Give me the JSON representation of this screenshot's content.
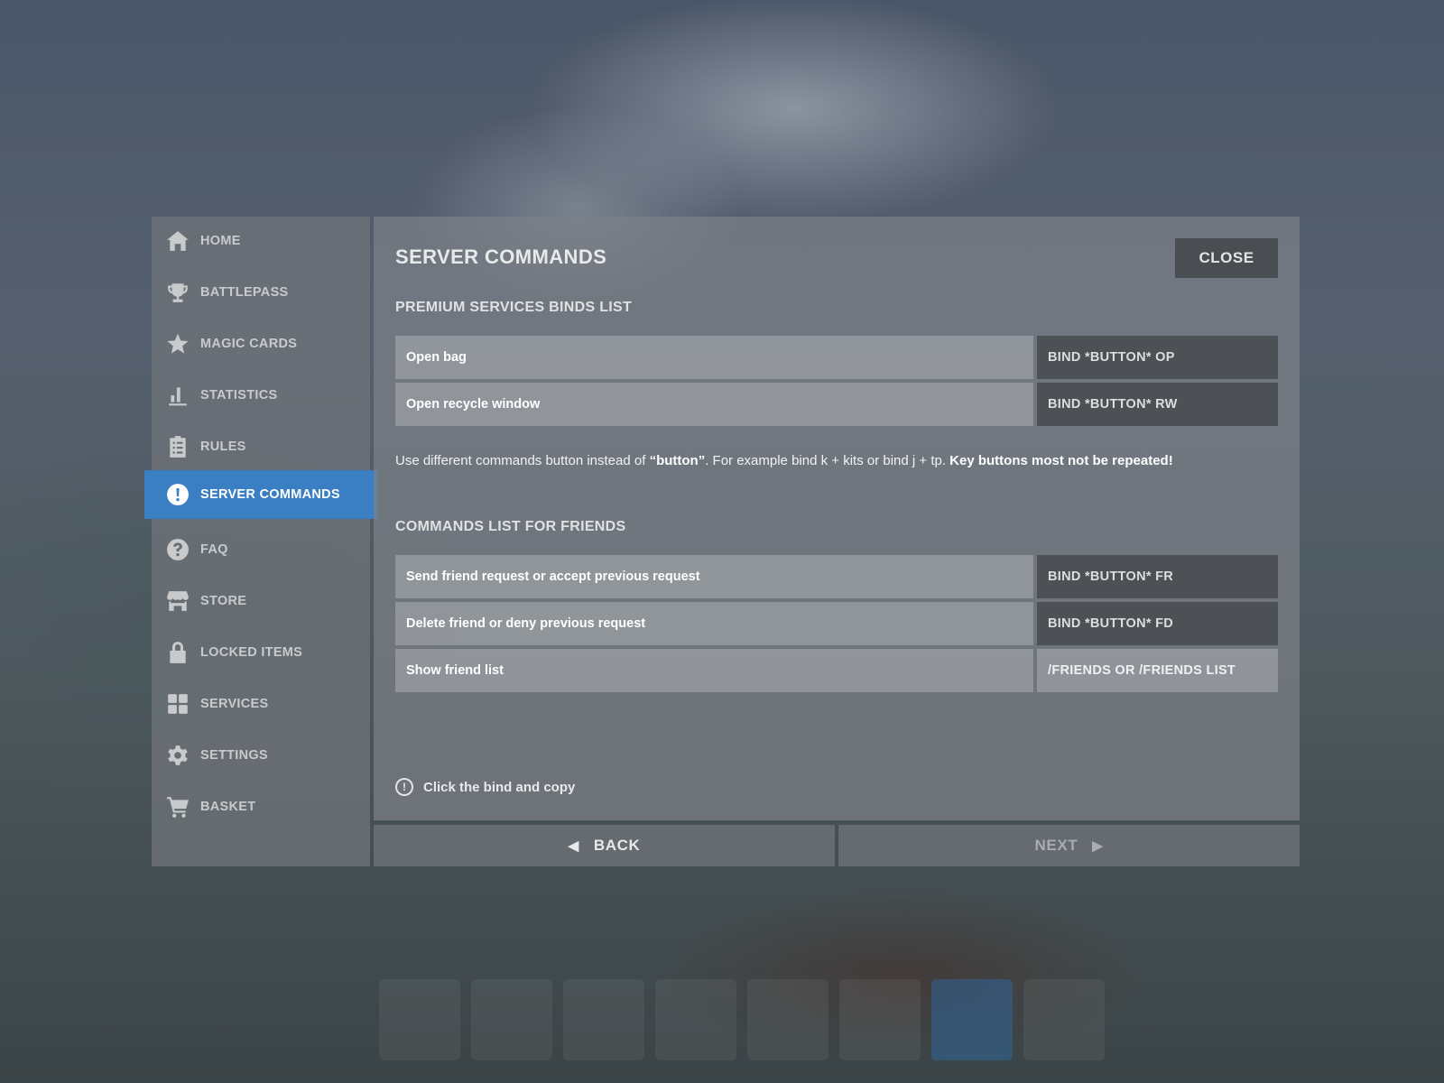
{
  "sidebar": {
    "items": [
      {
        "label": "HOME",
        "icon": "home-icon"
      },
      {
        "label": "BATTLEPASS",
        "icon": "trophy-icon"
      },
      {
        "label": "MAGIC CARDS",
        "icon": "star-icon"
      },
      {
        "label": "STATISTICS",
        "icon": "bar-chart-icon"
      },
      {
        "label": "RULES",
        "icon": "clipboard-icon"
      },
      {
        "label": "SERVER COMMANDS",
        "icon": "exclamation-circle-icon",
        "active": true
      },
      {
        "label": "FAQ",
        "icon": "question-circle-icon"
      },
      {
        "label": "STORE",
        "icon": "store-icon"
      },
      {
        "label": "LOCKED ITEMS",
        "icon": "lock-icon"
      },
      {
        "label": "SERVICES",
        "icon": "grid-icon"
      },
      {
        "label": "SETTINGS",
        "icon": "gear-icon"
      },
      {
        "label": "BASKET",
        "icon": "cart-icon"
      }
    ],
    "active_color": "#3a7fc4"
  },
  "main": {
    "title": "SERVER COMMANDS",
    "close_label": "CLOSE",
    "premium": {
      "title": "PREMIUM SERVICES BINDS LIST",
      "rows": [
        {
          "desc": "Open bag",
          "bind": "BIND *BUTTON* OP"
        },
        {
          "desc": "Open recycle window",
          "bind": "BIND *BUTTON* RW"
        }
      ]
    },
    "note": {
      "text1": "Use different commands button instead of ",
      "bold1": "“button”",
      "text2": ". For example bind k + kits or bind j + tp. ",
      "bold2": "Key buttons most not be repeated!"
    },
    "friends": {
      "title": "COMMANDS LIST FOR FRIENDS",
      "rows": [
        {
          "desc": "Send friend request or accept previous request",
          "bind": "BIND *BUTTON* FR"
        },
        {
          "desc": "Delete friend or deny previous request",
          "bind": "BIND *BUTTON* FD"
        },
        {
          "desc": "Show friend list",
          "bind": "/FRIENDS OR /FRIENDS LIST"
        }
      ]
    },
    "hint": "Click the bind and copy"
  },
  "footer": {
    "back_label": "BACK",
    "next_label": "NEXT"
  }
}
